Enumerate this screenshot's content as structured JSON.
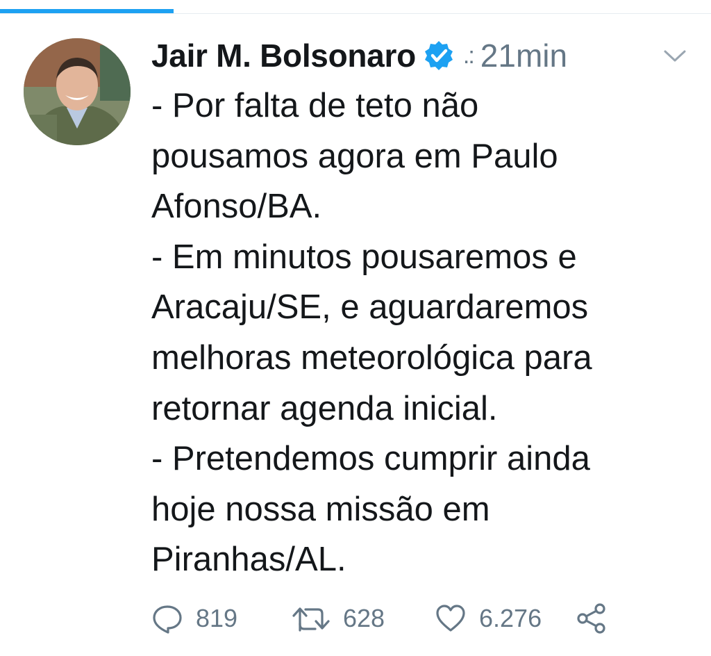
{
  "colors": {
    "accent": "#1da1f2",
    "secondary_text": "#657786",
    "primary_text": "#14171a",
    "verified": "#1da1f2"
  },
  "tweet": {
    "author_name": "Jair M. Bolsonaro",
    "verified_icon": "verified-badge-icon",
    "separator": ".:",
    "timestamp": "21min",
    "menu_icon": "chevron-down-icon",
    "text_lines": [
      "- Por falta de teto não",
      "pousamos agora em Paulo",
      "Afonso/BA.",
      "- Em minutos pousaremos e",
      "Aracaju/SE, e aguardaremos",
      "melhoras meteorológica para",
      "retornar agenda inicial.",
      "- Pretendemos cumprir ainda",
      "hoje nossa missão em",
      "Piranhas/AL."
    ]
  },
  "actions": {
    "reply": {
      "icon": "reply-icon",
      "count": "819"
    },
    "retweet": {
      "icon": "retweet-icon",
      "count": "628"
    },
    "like": {
      "icon": "heart-icon",
      "count": "6.276"
    },
    "share": {
      "icon": "share-icon"
    }
  }
}
